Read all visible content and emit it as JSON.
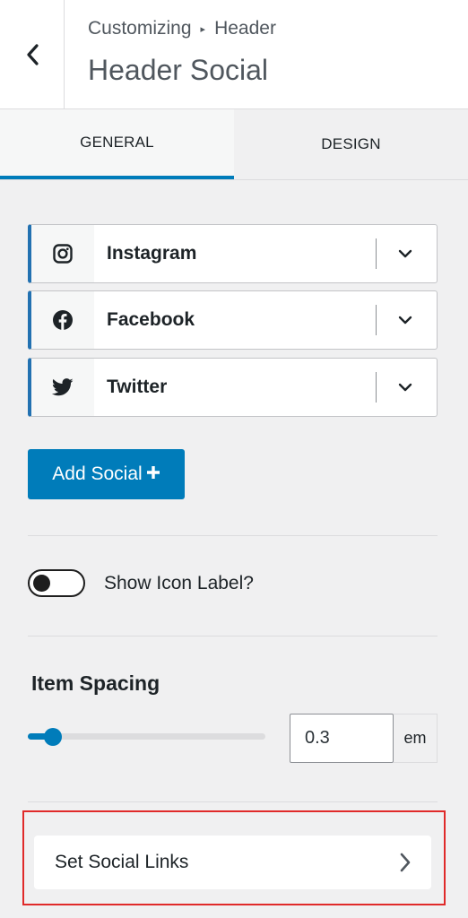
{
  "header": {
    "breadcrumb_parent": "Customizing",
    "breadcrumb_separator": "▸",
    "breadcrumb_current": "Header",
    "title": "Header Social"
  },
  "tabs": [
    {
      "label": "GENERAL",
      "active": true
    },
    {
      "label": "DESIGN",
      "active": false
    }
  ],
  "social_items": [
    {
      "label": "Instagram",
      "icon": "instagram-icon"
    },
    {
      "label": "Facebook",
      "icon": "facebook-icon"
    },
    {
      "label": "Twitter",
      "icon": "twitter-icon"
    }
  ],
  "add_social": {
    "label": "Add Social",
    "icon": "plus-icon"
  },
  "toggle": {
    "label": "Show Icon Label?",
    "checked": false
  },
  "item_spacing": {
    "title": "Item Spacing",
    "value": "0.3",
    "unit": "em",
    "slider_fraction": 0.1
  },
  "set_social_links": {
    "label": "Set Social Links"
  },
  "colors": {
    "accent": "#007cba",
    "highlight": "#e02a2a",
    "background": "#f0f0f1"
  }
}
